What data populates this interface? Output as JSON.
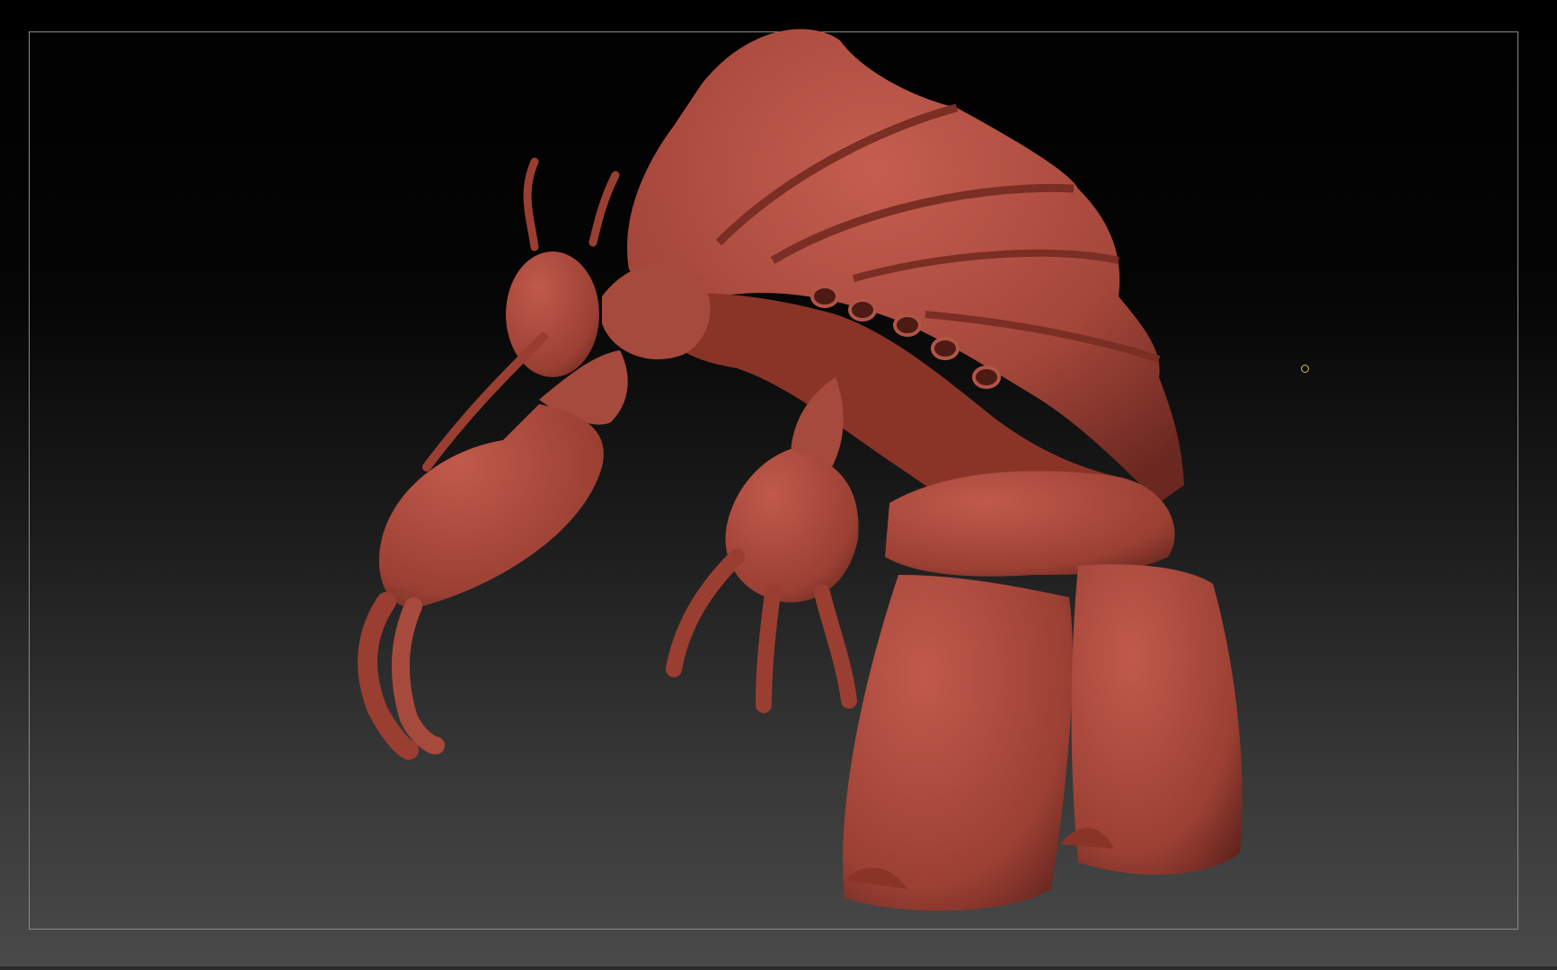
{
  "viewport": {
    "background_top": "#000000",
    "background_bottom": "#4a4a4a",
    "frame_color": "#8a8a8a"
  },
  "model": {
    "material_color": "#a4463a",
    "highlight_color": "#c96a5c",
    "shadow_color": "#5e221b"
  },
  "pivot": {
    "icon": "circle-marker-icon",
    "color": "#d6c832"
  }
}
